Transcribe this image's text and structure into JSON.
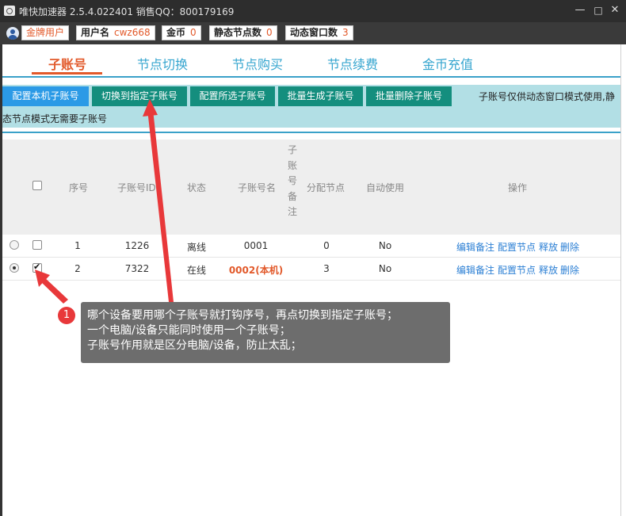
{
  "titlebar": {
    "title": "唯快加速器 2.5.4.022401  销售QQ：800179169",
    "minimize": "—",
    "maximize": "□",
    "close": "✕"
  },
  "status": {
    "level": "金牌用户",
    "username_label": "用户名",
    "username_value": "cwz668",
    "coins_label": "金币",
    "coins_value": "0",
    "static_label": "静态节点数",
    "static_value": "0",
    "dynamic_label": "动态窗口数",
    "dynamic_value": "3"
  },
  "tabs": [
    {
      "label": "子账号",
      "active": true
    },
    {
      "label": "节点切换"
    },
    {
      "label": "节点购买"
    },
    {
      "label": "节点续费"
    },
    {
      "label": "金币充值"
    }
  ],
  "toolbar": {
    "buttons": [
      "配置本机子账号",
      "切换到指定子账号",
      "配置所选子账号",
      "批量生成子账号",
      "批量删除子账号"
    ],
    "note_line1": "子账号仅供动态窗口模式使用,静",
    "note_line2": "态节点模式无需要子账号"
  },
  "table": {
    "headers": {
      "index": "序号",
      "id": "子账号ID",
      "status": "状态",
      "name": "子账号名",
      "remark": "子账号备注",
      "node": "分配节点",
      "auto": "自动使用",
      "ops": "操作"
    },
    "rows": [
      {
        "index": "1",
        "id": "1226",
        "status": "离线",
        "name": "0001",
        "node": "0",
        "auto": "No",
        "selected": false,
        "checked": false
      },
      {
        "index": "2",
        "id": "7322",
        "status": "在线",
        "name": "0002(本机)",
        "node": "3",
        "auto": "No",
        "selected": true,
        "checked": true
      }
    ],
    "actions": [
      "编辑备注",
      "配置节点",
      "释放",
      "删除"
    ]
  },
  "annotation": {
    "badge": "1",
    "lines": [
      "哪个设备要用哪个子账号就打钩序号，再点切换到指定子账号；",
      "一个电脑/设备只能同时使用一个子账号；",
      "子账号作用就是区分电脑/设备，防止太乱；"
    ],
    "arrow_color": "#e8383a"
  }
}
